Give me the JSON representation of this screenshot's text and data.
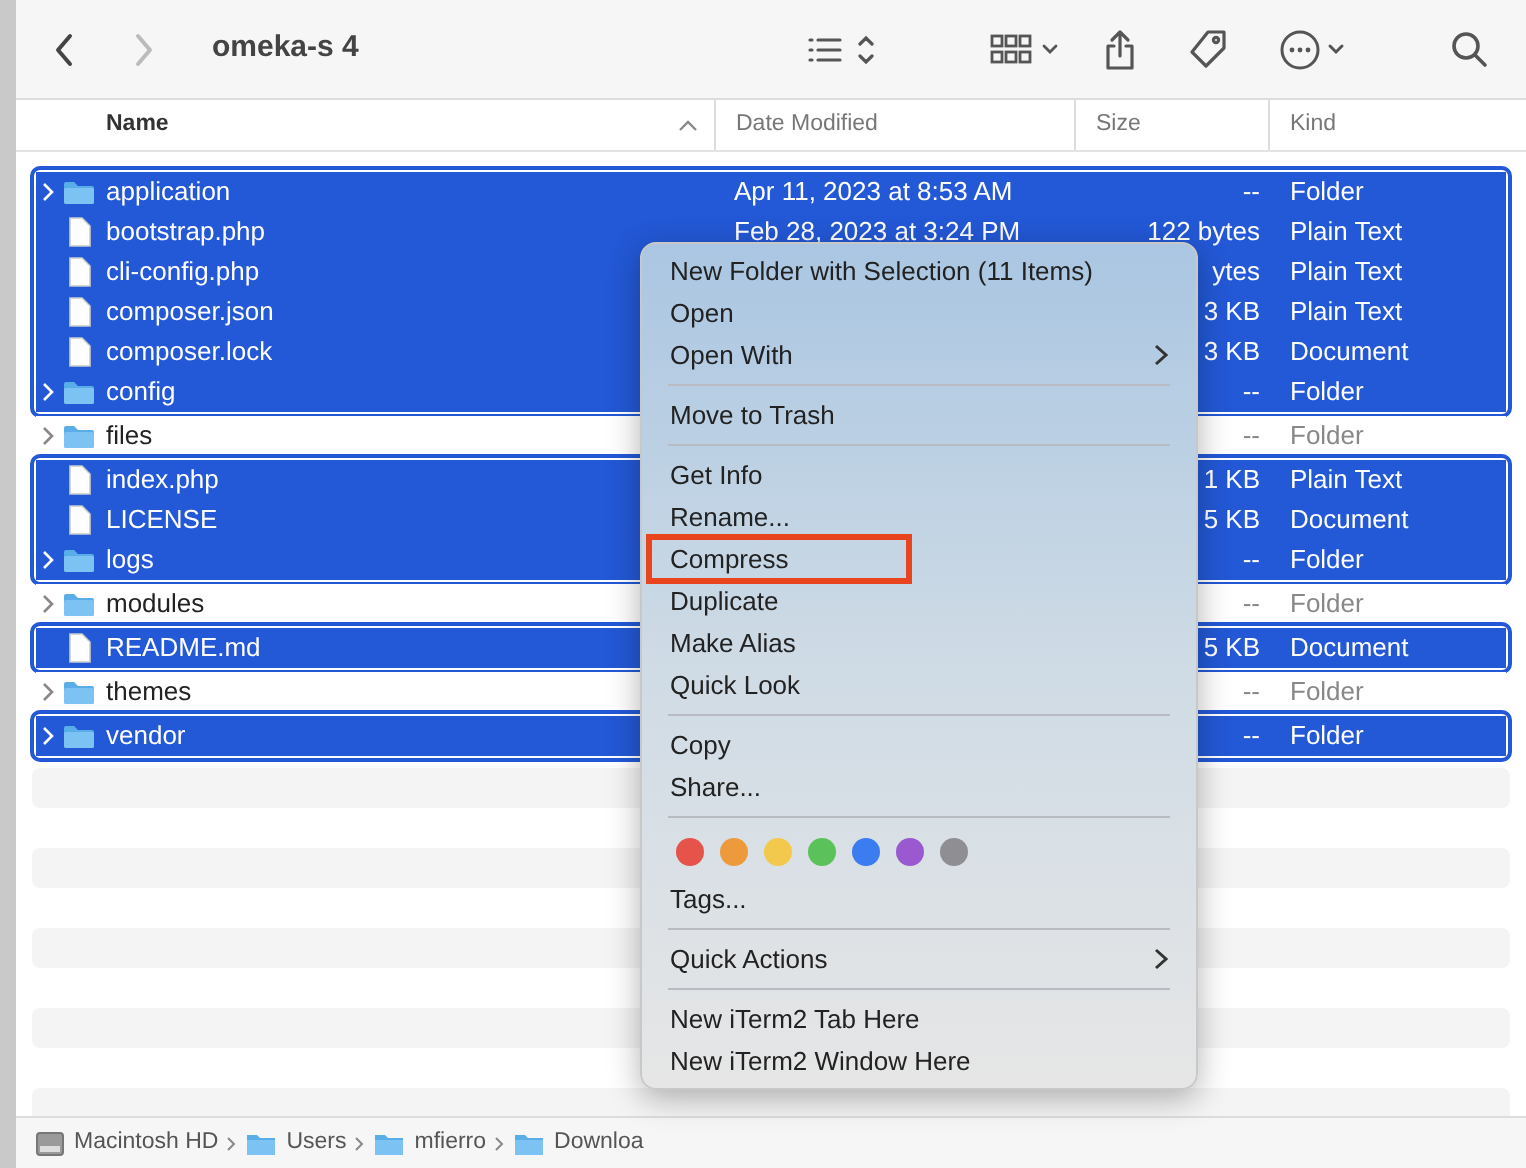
{
  "window": {
    "title": "omeka-s 4"
  },
  "toolbar": {
    "back_enabled": true,
    "forward_enabled": false
  },
  "table": {
    "columns": [
      {
        "label": "Name",
        "sorted": true
      },
      {
        "label": "Date Modified",
        "sorted": false
      },
      {
        "label": "Size",
        "sorted": false
      },
      {
        "label": "Kind",
        "sorted": false
      }
    ],
    "rows": [
      {
        "name": "application",
        "kind": "folder",
        "date": "Apr 11, 2023 at 8:53 AM",
        "size": "--",
        "kind_label": "Folder",
        "selected": true
      },
      {
        "name": "bootstrap.php",
        "kind": "file",
        "date": "Feb 28, 2023 at 3:24 PM",
        "size": "122 bytes",
        "kind_label": "Plain Text",
        "selected": true
      },
      {
        "name": "cli-config.php",
        "kind": "file",
        "size": "ytes",
        "kind_label": "Plain Text",
        "selected": true
      },
      {
        "name": "composer.json",
        "kind": "file",
        "size": "3 KB",
        "kind_label": "Plain Text",
        "selected": true
      },
      {
        "name": "composer.lock",
        "kind": "file",
        "size": "3 KB",
        "kind_label": "Document",
        "selected": true
      },
      {
        "name": "config",
        "kind": "folder",
        "size": "--",
        "kind_label": "Folder",
        "selected": true
      },
      {
        "name": "files",
        "kind": "folder",
        "size": "--",
        "kind_label": "Folder",
        "selected": false
      },
      {
        "name": "index.php",
        "kind": "file",
        "size": "1 KB",
        "kind_label": "Plain Text",
        "selected": true
      },
      {
        "name": "LICENSE",
        "kind": "file",
        "size": "5 KB",
        "kind_label": "Document",
        "selected": true
      },
      {
        "name": "logs",
        "kind": "folder",
        "size": "--",
        "kind_label": "Folder",
        "selected": true
      },
      {
        "name": "modules",
        "kind": "folder",
        "size": "--",
        "kind_label": "Folder",
        "selected": false
      },
      {
        "name": "README.md",
        "kind": "file",
        "size": "5 KB",
        "kind_label": "Document",
        "selected": true
      },
      {
        "name": "themes",
        "kind": "folder",
        "size": "--",
        "kind_label": "Folder",
        "selected": false
      },
      {
        "name": "vendor",
        "kind": "folder",
        "size": "--",
        "kind_label": "Folder",
        "selected": true
      }
    ]
  },
  "context_menu": {
    "items": [
      {
        "kind": "item",
        "label": "New Folder with Selection (11 Items)",
        "submenu": false,
        "highlighted": false
      },
      {
        "kind": "item",
        "label": "Open",
        "submenu": false,
        "highlighted": false
      },
      {
        "kind": "item",
        "label": "Open With",
        "submenu": true,
        "highlighted": false
      },
      {
        "kind": "separator"
      },
      {
        "kind": "item",
        "label": "Move to Trash",
        "submenu": false,
        "highlighted": false
      },
      {
        "kind": "separator"
      },
      {
        "kind": "item",
        "label": "Get Info",
        "submenu": false,
        "highlighted": false
      },
      {
        "kind": "item",
        "label": "Rename...",
        "submenu": false,
        "highlighted": false
      },
      {
        "kind": "item",
        "label": "Compress",
        "submenu": false,
        "highlighted": true
      },
      {
        "kind": "item",
        "label": "Duplicate",
        "submenu": false,
        "highlighted": false
      },
      {
        "kind": "item",
        "label": "Make Alias",
        "submenu": false,
        "highlighted": false
      },
      {
        "kind": "item",
        "label": "Quick Look",
        "submenu": false,
        "highlighted": false
      },
      {
        "kind": "separator"
      },
      {
        "kind": "item",
        "label": "Copy",
        "submenu": false,
        "highlighted": false
      },
      {
        "kind": "item",
        "label": "Share...",
        "submenu": false,
        "highlighted": false
      },
      {
        "kind": "separator"
      },
      {
        "kind": "colors",
        "tags": [
          {
            "color": "#e5534b"
          },
          {
            "color": "#ec9a3c"
          },
          {
            "color": "#f2c94c"
          },
          {
            "color": "#5bc25b"
          },
          {
            "color": "#3b7cf0"
          },
          {
            "color": "#9b59d0"
          },
          {
            "color": "#8e8e93"
          }
        ]
      },
      {
        "kind": "item",
        "label": "Tags...",
        "submenu": false,
        "highlighted": false
      },
      {
        "kind": "separator"
      },
      {
        "kind": "item",
        "label": "Quick Actions",
        "submenu": true,
        "highlighted": false
      },
      {
        "kind": "separator"
      },
      {
        "kind": "item",
        "label": "New iTerm2 Tab Here",
        "submenu": false,
        "highlighted": false
      },
      {
        "kind": "item",
        "label": "New iTerm2 Window Here",
        "submenu": false,
        "highlighted": false
      }
    ]
  },
  "path_bar": [
    {
      "label": "Macintosh HD"
    },
    {
      "label": "Users"
    },
    {
      "label": "mfierro"
    },
    {
      "label": "Downloa"
    }
  ]
}
